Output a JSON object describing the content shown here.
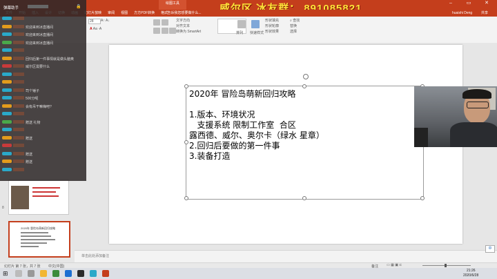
{
  "banner": {
    "text": "威尔区 冰友群： 891085821"
  },
  "ribbon": {
    "tabs": [
      "文件",
      "开始",
      "插入",
      "设计",
      "切换",
      "动画",
      "幻灯片放映",
      "审阅",
      "视图",
      "方方PDF转换",
      "格式"
    ],
    "contextual_tab": "绘图工具",
    "search_placeholder": "告诉我您想要做什么...",
    "user": "huaishi Deng",
    "share": "共享",
    "font_size": "28",
    "text_direction": "文字方向",
    "align_text": "对齐文本",
    "convert_smartart": "转换为 SmartArt",
    "arrange": "排列",
    "quick_styles": "快速样式",
    "shape_fill": "形状填充",
    "shape_outline": "形状轮廓",
    "shape_effects": "形状效果",
    "find": "查找",
    "replace": "替换",
    "select": "选择"
  },
  "chat": {
    "header": "弹幕助手",
    "rows": [
      {
        "badge": "",
        "user": "",
        "text": ""
      },
      {
        "badge": "",
        "user": "",
        "text": "欢迎来到冰直播间"
      },
      {
        "badge": "",
        "user": "",
        "text": "欢迎来到冰直播间"
      },
      {
        "badge": "",
        "user": "",
        "text": "欢迎来到冰直播间"
      },
      {
        "badge": "",
        "user": "",
        "text": ""
      },
      {
        "badge": "",
        "user": "",
        "text": "回归后第一件事情就是做头脑奥"
      },
      {
        "badge": "",
        "user": "",
        "text": "威尔区需要什么"
      },
      {
        "badge": "",
        "user": "",
        "text": ""
      },
      {
        "badge": "",
        "user": "",
        "text": ""
      },
      {
        "badge": "",
        "user": "",
        "text": "司个锤子"
      },
      {
        "badge": "",
        "user": "",
        "text": "500分呢"
      },
      {
        "badge": "",
        "user": "",
        "text": "会有吊干嘛嗨吧?"
      },
      {
        "badge": "",
        "user": "",
        "text": ""
      },
      {
        "badge": "",
        "user": "",
        "text": "赠送 礼物"
      },
      {
        "badge": "",
        "user": "",
        "text": ""
      },
      {
        "badge": "",
        "user": "",
        "text": "赠送"
      },
      {
        "badge": "",
        "user": "",
        "text": ""
      },
      {
        "badge": "",
        "user": "",
        "text": "赠送"
      },
      {
        "badge": "",
        "user": "",
        "text": "赠送"
      },
      {
        "badge": "",
        "user": "",
        "text": ""
      }
    ]
  },
  "slide": {
    "lines": [
      "2020年 冒险岛萌新回归攻略",
      "",
      "1.版本、环境状况",
      "   支援系统 限制工作室  合区",
      "露西德、威尔、奥尔卡（绿水 星章）",
      "2.回归后要做的第一件事",
      "3.装备打造"
    ]
  },
  "thumbnails": [
    {
      "num": "",
      "title": ""
    },
    {
      "num": "",
      "title": ""
    },
    {
      "num": "8",
      "title": "2020年 冒险岛萌新回归攻略"
    }
  ],
  "notes": {
    "placeholder": "单击此处添加备注"
  },
  "status": {
    "slide_info": "幻灯片 第 7 张，共 7 张",
    "language": "中文(中国)",
    "notes_btn": "备注",
    "zoom": "",
    "time": "21:26",
    "date": "2020/6/28"
  },
  "colors": {
    "accent": "#c43e1c",
    "banner": "#ffe23a"
  }
}
